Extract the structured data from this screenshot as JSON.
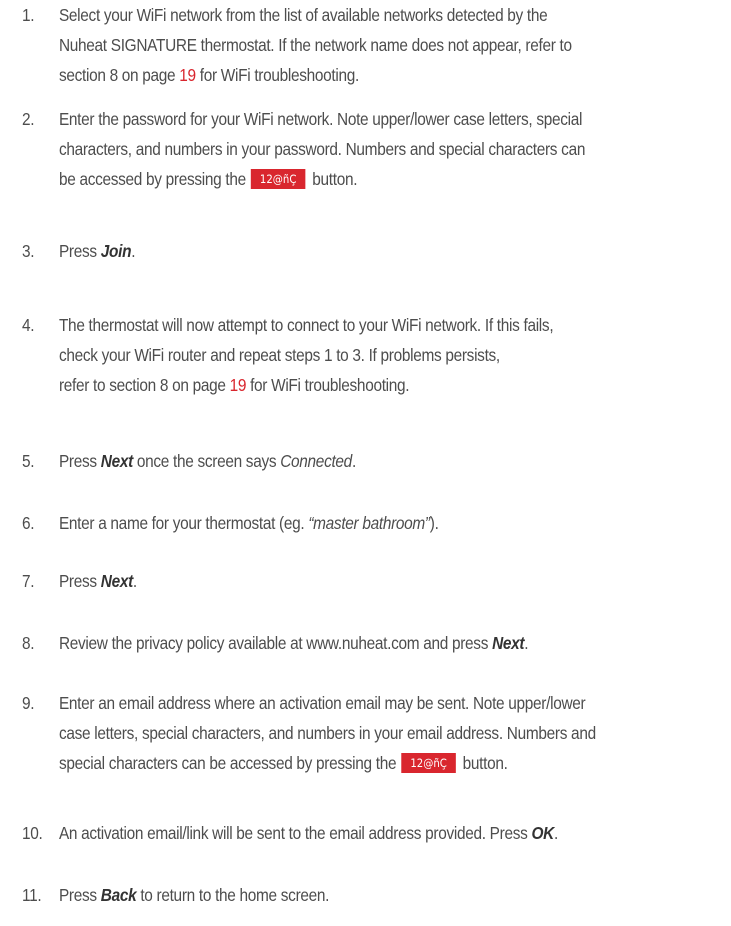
{
  "steps": [
    {
      "num": "1.",
      "lines": [
        [
          "Select your WiFi network from the list of available networks detected by the"
        ],
        [
          "Nuheat SIGNATURE thermostat. If the network name does not appear, refer to"
        ],
        [
          "section 8 on page ",
          {
            "link": "19"
          },
          " for WiFi troubleshooting."
        ]
      ]
    },
    {
      "num": "2.",
      "lines": [
        [
          "Enter the password for your WiFi network. Note upper/lower case letters, special"
        ],
        [
          "characters, and numbers in your password. Numbers and special characters can"
        ],
        [
          "be accessed by pressing the",
          {
            "kbd": "12@ñÇ"
          },
          "button."
        ]
      ]
    },
    {
      "num": "3.",
      "lines": [
        [
          "Press ",
          {
            "kw": "Join"
          },
          "."
        ]
      ]
    },
    {
      "num": "4.",
      "lines": [
        [
          "The thermostat will now attempt to connect to your WiFi network. If this fails,"
        ],
        [
          "check your WiFi router and repeat steps 1 to 3. If problems persists,"
        ],
        [
          "refer to section 8 on page ",
          {
            "link": "19"
          },
          " for WiFi troubleshooting."
        ]
      ]
    },
    {
      "num": "5.",
      "lines": [
        [
          "Press ",
          {
            "kw": "Next"
          },
          " once the screen says ",
          {
            "it": "Connected"
          },
          "."
        ]
      ]
    },
    {
      "num": "6.",
      "lines": [
        [
          "Enter a name for your thermostat (eg. ",
          {
            "it": "“master bathroom”"
          },
          ")."
        ]
      ]
    },
    {
      "num": "7.",
      "lines": [
        [
          "Press ",
          {
            "kw": "Next"
          },
          "."
        ]
      ]
    },
    {
      "num": "8.",
      "lines": [
        [
          "Review the privacy policy available at www.nuheat.com and press ",
          {
            "kw": "Next"
          },
          "."
        ]
      ]
    },
    {
      "num": "9.",
      "lines": [
        [
          "Enter an email address where an activation email may be sent. Note upper/lower"
        ],
        [
          "case letters, special characters, and numbers in your email address. Numbers and"
        ],
        [
          "special characters can be accessed by pressing the",
          {
            "kbd": "12@ñÇ"
          },
          "button."
        ]
      ]
    },
    {
      "num": "10.",
      "lines": [
        [
          "An activation email/link will be sent to the email address provided. Press ",
          {
            "kw": "OK"
          },
          "."
        ]
      ]
    },
    {
      "num": "11.",
      "lines": [
        [
          "Press ",
          {
            "kw": "Back"
          },
          " to return to the home screen."
        ]
      ]
    }
  ],
  "colors": {
    "text": "#4d4d4d",
    "accent": "#d9262e",
    "key_text": "#ffffff"
  }
}
